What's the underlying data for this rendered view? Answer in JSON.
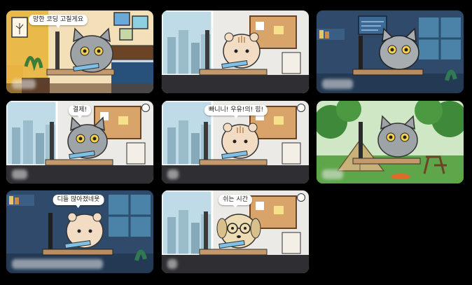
{
  "grid": {
    "cards": [
      {
        "caption": "망한 코딩 고칠게요",
        "scene": "cozy-bedroom",
        "character": "gray-cat"
      },
      {
        "caption": "",
        "scene": "office-window",
        "character": "hamster"
      },
      {
        "caption": "",
        "scene": "blue-night-room",
        "character": "gray-cat"
      },
      {
        "caption": "결제!",
        "scene": "office-window",
        "character": "gray-cat"
      },
      {
        "caption": "빠니니! 우유!의! 힘!",
        "scene": "office-window",
        "character": "hamster"
      },
      {
        "caption": "",
        "scene": "forest-camp",
        "character": "gray-cat"
      },
      {
        "caption": "디들 많아졌네욧",
        "scene": "blue-night-room",
        "character": "hamster"
      },
      {
        "caption": "쉬는 시간",
        "scene": "office-window",
        "character": "dog-with-glasses"
      }
    ]
  },
  "colors": {
    "background": "#000000",
    "bubble": "#ffffff"
  }
}
